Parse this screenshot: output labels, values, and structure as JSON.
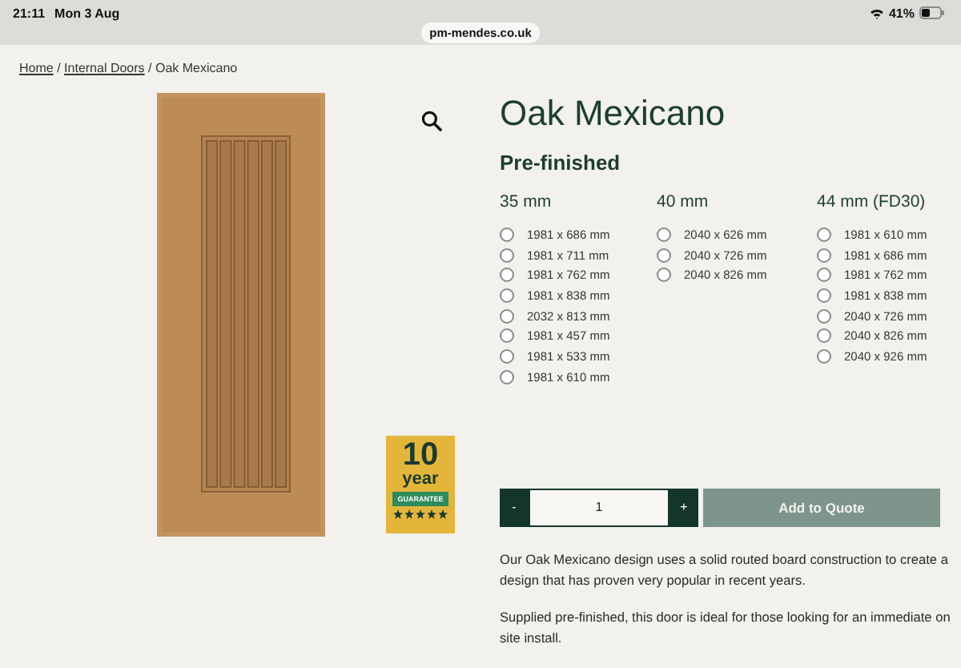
{
  "status_bar": {
    "time": "21:11",
    "date": "Mon 3 Aug",
    "battery": "41%"
  },
  "address_bar": {
    "url": "pm-mendes.co.uk"
  },
  "breadcrumb": [
    {
      "label": "Home",
      "kind": "link"
    },
    {
      "label": "/",
      "kind": "separator"
    },
    {
      "label": "Internal Doors",
      "kind": "link"
    },
    {
      "label": "/",
      "kind": "separator"
    },
    {
      "label": "Oak Mexicano",
      "kind": "current"
    }
  ],
  "product": {
    "title": "Oak Mexicano",
    "finish": "Pre-finished"
  },
  "size_groups": [
    {
      "heading": "35 mm",
      "options": [
        {
          "label": "1981 x 686 mm",
          "selected": false
        },
        {
          "label": "1981 x 711 mm",
          "selected": false
        },
        {
          "label": "1981 x 762 mm",
          "selected": false
        },
        {
          "label": "1981 x 838 mm",
          "selected": false
        },
        {
          "label": "2032 x 813 mm",
          "selected": false
        },
        {
          "label": "1981 x 457 mm",
          "selected": false
        },
        {
          "label": "1981 x 533 mm",
          "selected": false
        },
        {
          "label": "1981 x 610 mm",
          "selected": false
        }
      ]
    },
    {
      "heading": "40 mm",
      "options": [
        {
          "label": "2040 x 626 mm",
          "selected": false
        },
        {
          "label": "2040 x 726 mm",
          "selected": false
        },
        {
          "label": "2040 x 826 mm",
          "selected": false
        }
      ]
    },
    {
      "heading": "44 mm (FD30)",
      "options": [
        {
          "label": "1981 x 610 mm",
          "selected": false
        },
        {
          "label": "1981 x 686 mm",
          "selected": false
        },
        {
          "label": "1981 x 762 mm",
          "selected": false
        },
        {
          "label": "1981 x 838 mm",
          "selected": false
        },
        {
          "label": "2040 x 726 mm",
          "selected": false
        },
        {
          "label": "2040 x 826 mm",
          "selected": false
        },
        {
          "label": "2040 x 926 mm",
          "selected": false
        }
      ]
    }
  ],
  "badge": {
    "number": "10",
    "unit": "year",
    "label": "GUARANTEE",
    "stars": 5
  },
  "quantity": {
    "minus": "-",
    "value": "1",
    "plus": "+"
  },
  "add_button": {
    "label": "Add to Quote"
  },
  "description": [
    "Our Oak Mexicano design uses a solid routed board construction to create a design that has proven very popular in recent years.",
    "Supplied pre-finished, this door is ideal for those looking for an immediate on site install."
  ]
}
